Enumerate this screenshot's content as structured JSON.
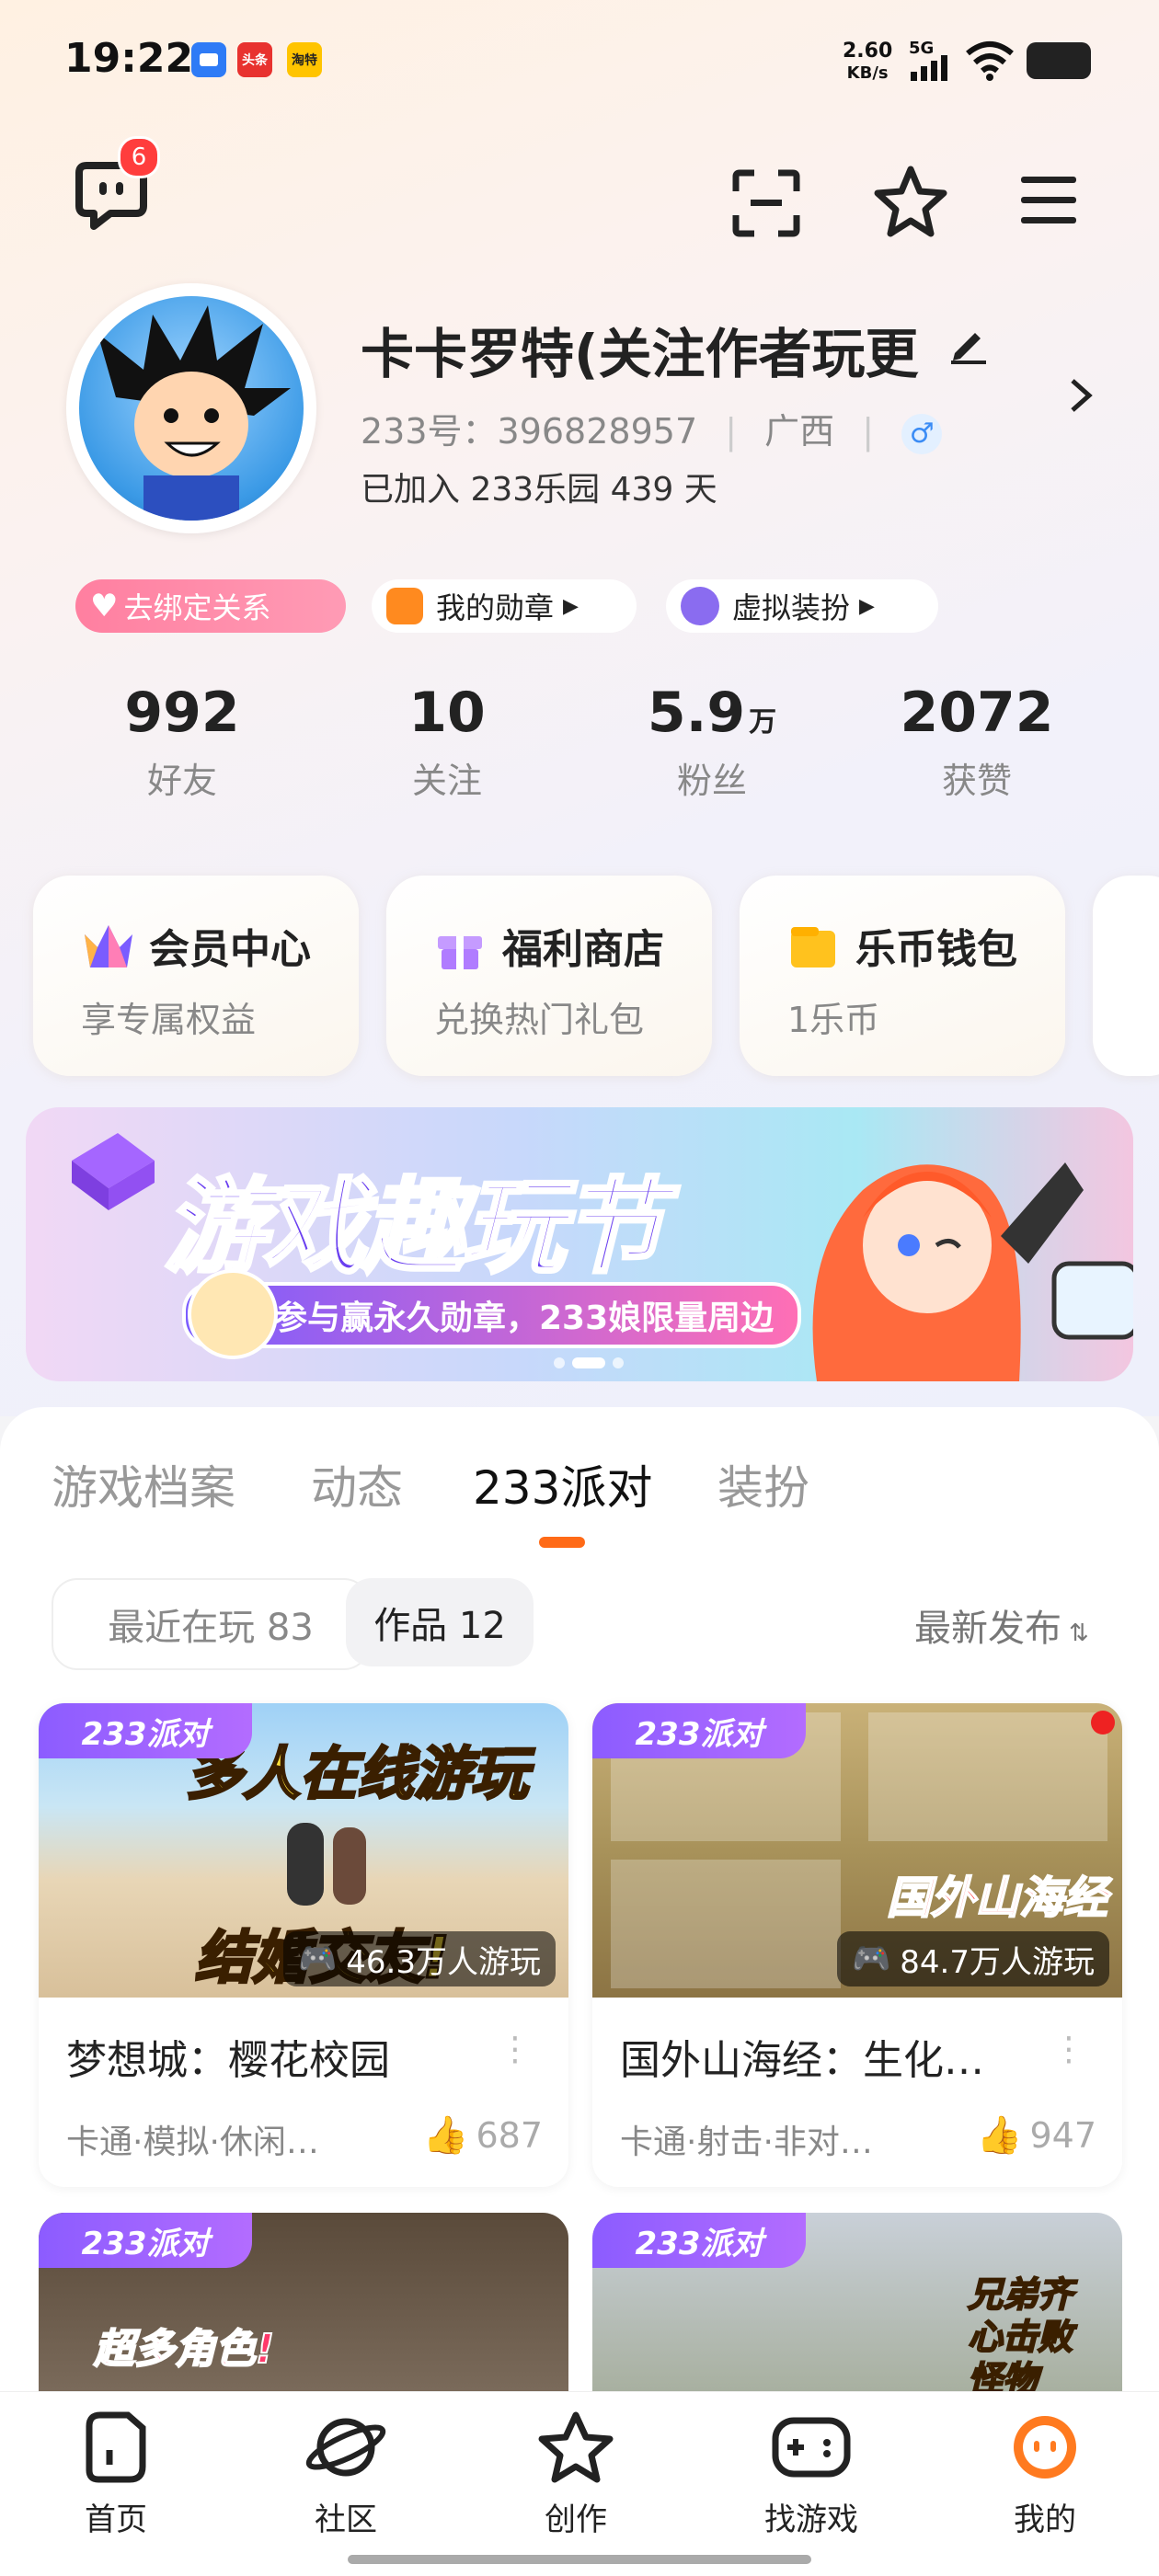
{
  "status_bar": {
    "time": "19:22",
    "apps": [
      "头条",
      "淘特"
    ],
    "net_speed_value": "2.60",
    "net_speed_unit": "KB/s",
    "signal": "5G"
  },
  "header": {
    "message_badge": "6"
  },
  "profile": {
    "username": "卡卡罗特(关注作者玩更",
    "uid_label": "233号：",
    "uid": "396828957",
    "region": "广西",
    "joined": "已加入 233乐园 439 天"
  },
  "chips": {
    "unbind": "去绑定关系",
    "medals": "我的勋章",
    "avatar": "虚拟装扮"
  },
  "stats": [
    {
      "value": "992",
      "unit": "",
      "label": "好友"
    },
    {
      "value": "10",
      "unit": "",
      "label": "关注"
    },
    {
      "value": "5.9",
      "unit": "万",
      "label": "粉丝"
    },
    {
      "value": "2072",
      "unit": "",
      "label": "获赞"
    }
  ],
  "cards": [
    {
      "title": "会员中心",
      "subtitle": "享专属权益"
    },
    {
      "title": "福利商店",
      "subtitle": "兑换热门礼包"
    },
    {
      "title": "乐币钱包",
      "subtitle": "1乐币"
    }
  ],
  "banner": {
    "title": "游戏趣玩节",
    "subtitle": "参与赢永久勋章，233娘限量周边"
  },
  "tabs": [
    "游戏档案",
    "动态",
    "233派对",
    "装扮"
  ],
  "filters": {
    "recent": "最近在玩 83",
    "works": "作品 12",
    "sort": "最新发布"
  },
  "games": [
    {
      "tag": "233派对",
      "overlay_text": "多人在线游玩",
      "overlay_text2": "结婚交友!",
      "plays": "46.3万人游玩",
      "name": "梦想城：樱花校园",
      "tags": "卡通·模拟·休闲…",
      "likes": "687"
    },
    {
      "tag": "233派对",
      "overlay_text": "国外山海经",
      "plays": "84.7万人游玩",
      "name": "国外山海经：生化…",
      "tags": "卡通·射击·非对…",
      "likes": "947"
    },
    {
      "tag": "233派对",
      "overlay_text": "超多角色!"
    },
    {
      "tag": "233派对",
      "overlay_text": "兄弟齐心击败怪物"
    }
  ],
  "nav": [
    {
      "label": "首页"
    },
    {
      "label": "社区"
    },
    {
      "label": "创作"
    },
    {
      "label": "找游戏"
    },
    {
      "label": "我的"
    }
  ],
  "colors": {
    "accent": "#ff6a17",
    "party_purple": "#8c5cff"
  }
}
